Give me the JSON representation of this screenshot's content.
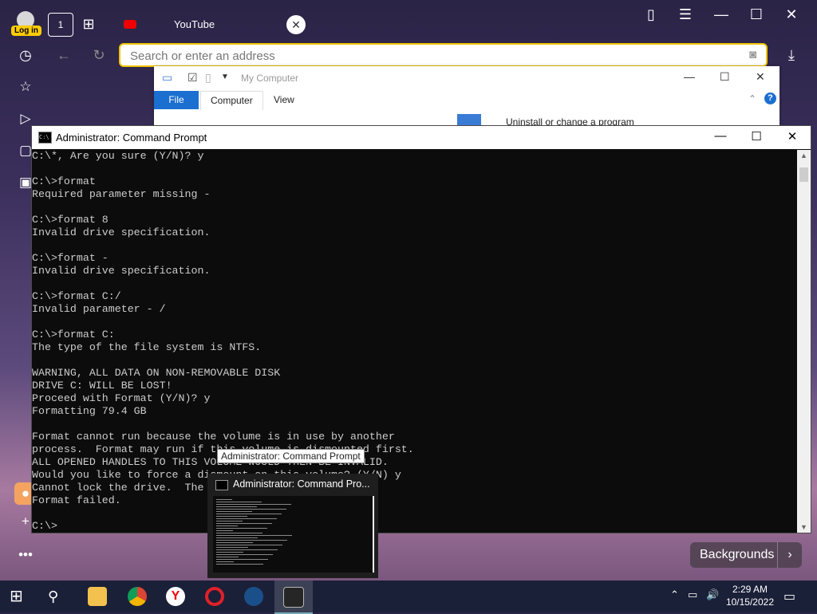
{
  "browser": {
    "login_label": "Log in",
    "tab_count": "1",
    "tab_title": "YouTube",
    "address_placeholder": "Search or enter an address"
  },
  "explorer": {
    "title": "My Computer",
    "ribbon": [
      "File",
      "Computer",
      "View"
    ],
    "uninstall_label": "Uninstall or change a program"
  },
  "cmd": {
    "title": "Administrator: Command Prompt",
    "lines": [
      "C:\\*, Are you sure (Y/N)? y",
      "",
      "C:\\>format",
      "Required parameter missing -",
      "",
      "C:\\>format 8",
      "Invalid drive specification.",
      "",
      "C:\\>format -",
      "Invalid drive specification.",
      "",
      "C:\\>format C:/",
      "Invalid parameter - /",
      "",
      "C:\\>format C:",
      "The type of the file system is NTFS.",
      "",
      "WARNING, ALL DATA ON NON-REMOVABLE DISK",
      "DRIVE C: WILL BE LOST!",
      "Proceed with Format (Y/N)? y",
      "Formatting 79.4 GB",
      "",
      "Format cannot run because the volume is in use by another",
      "process.  Format may run if this volume is dismounted first.",
      "ALL OPENED HANDLES TO THIS VOLUME WOULD THEN BE INVALID.",
      "Would you like to force a dismount on this volume? (Y/N) y",
      "Cannot lock the drive.  The volume is still in use.",
      "Format failed.",
      "",
      "C:\\>"
    ]
  },
  "tooltip": "Administrator: Command Prompt",
  "thumbnail_title": "Administrator: Command Pro...",
  "backgrounds_label": "Backgrounds",
  "taskbar": {
    "time": "2:29 AM",
    "date": "10/15/2022"
  }
}
